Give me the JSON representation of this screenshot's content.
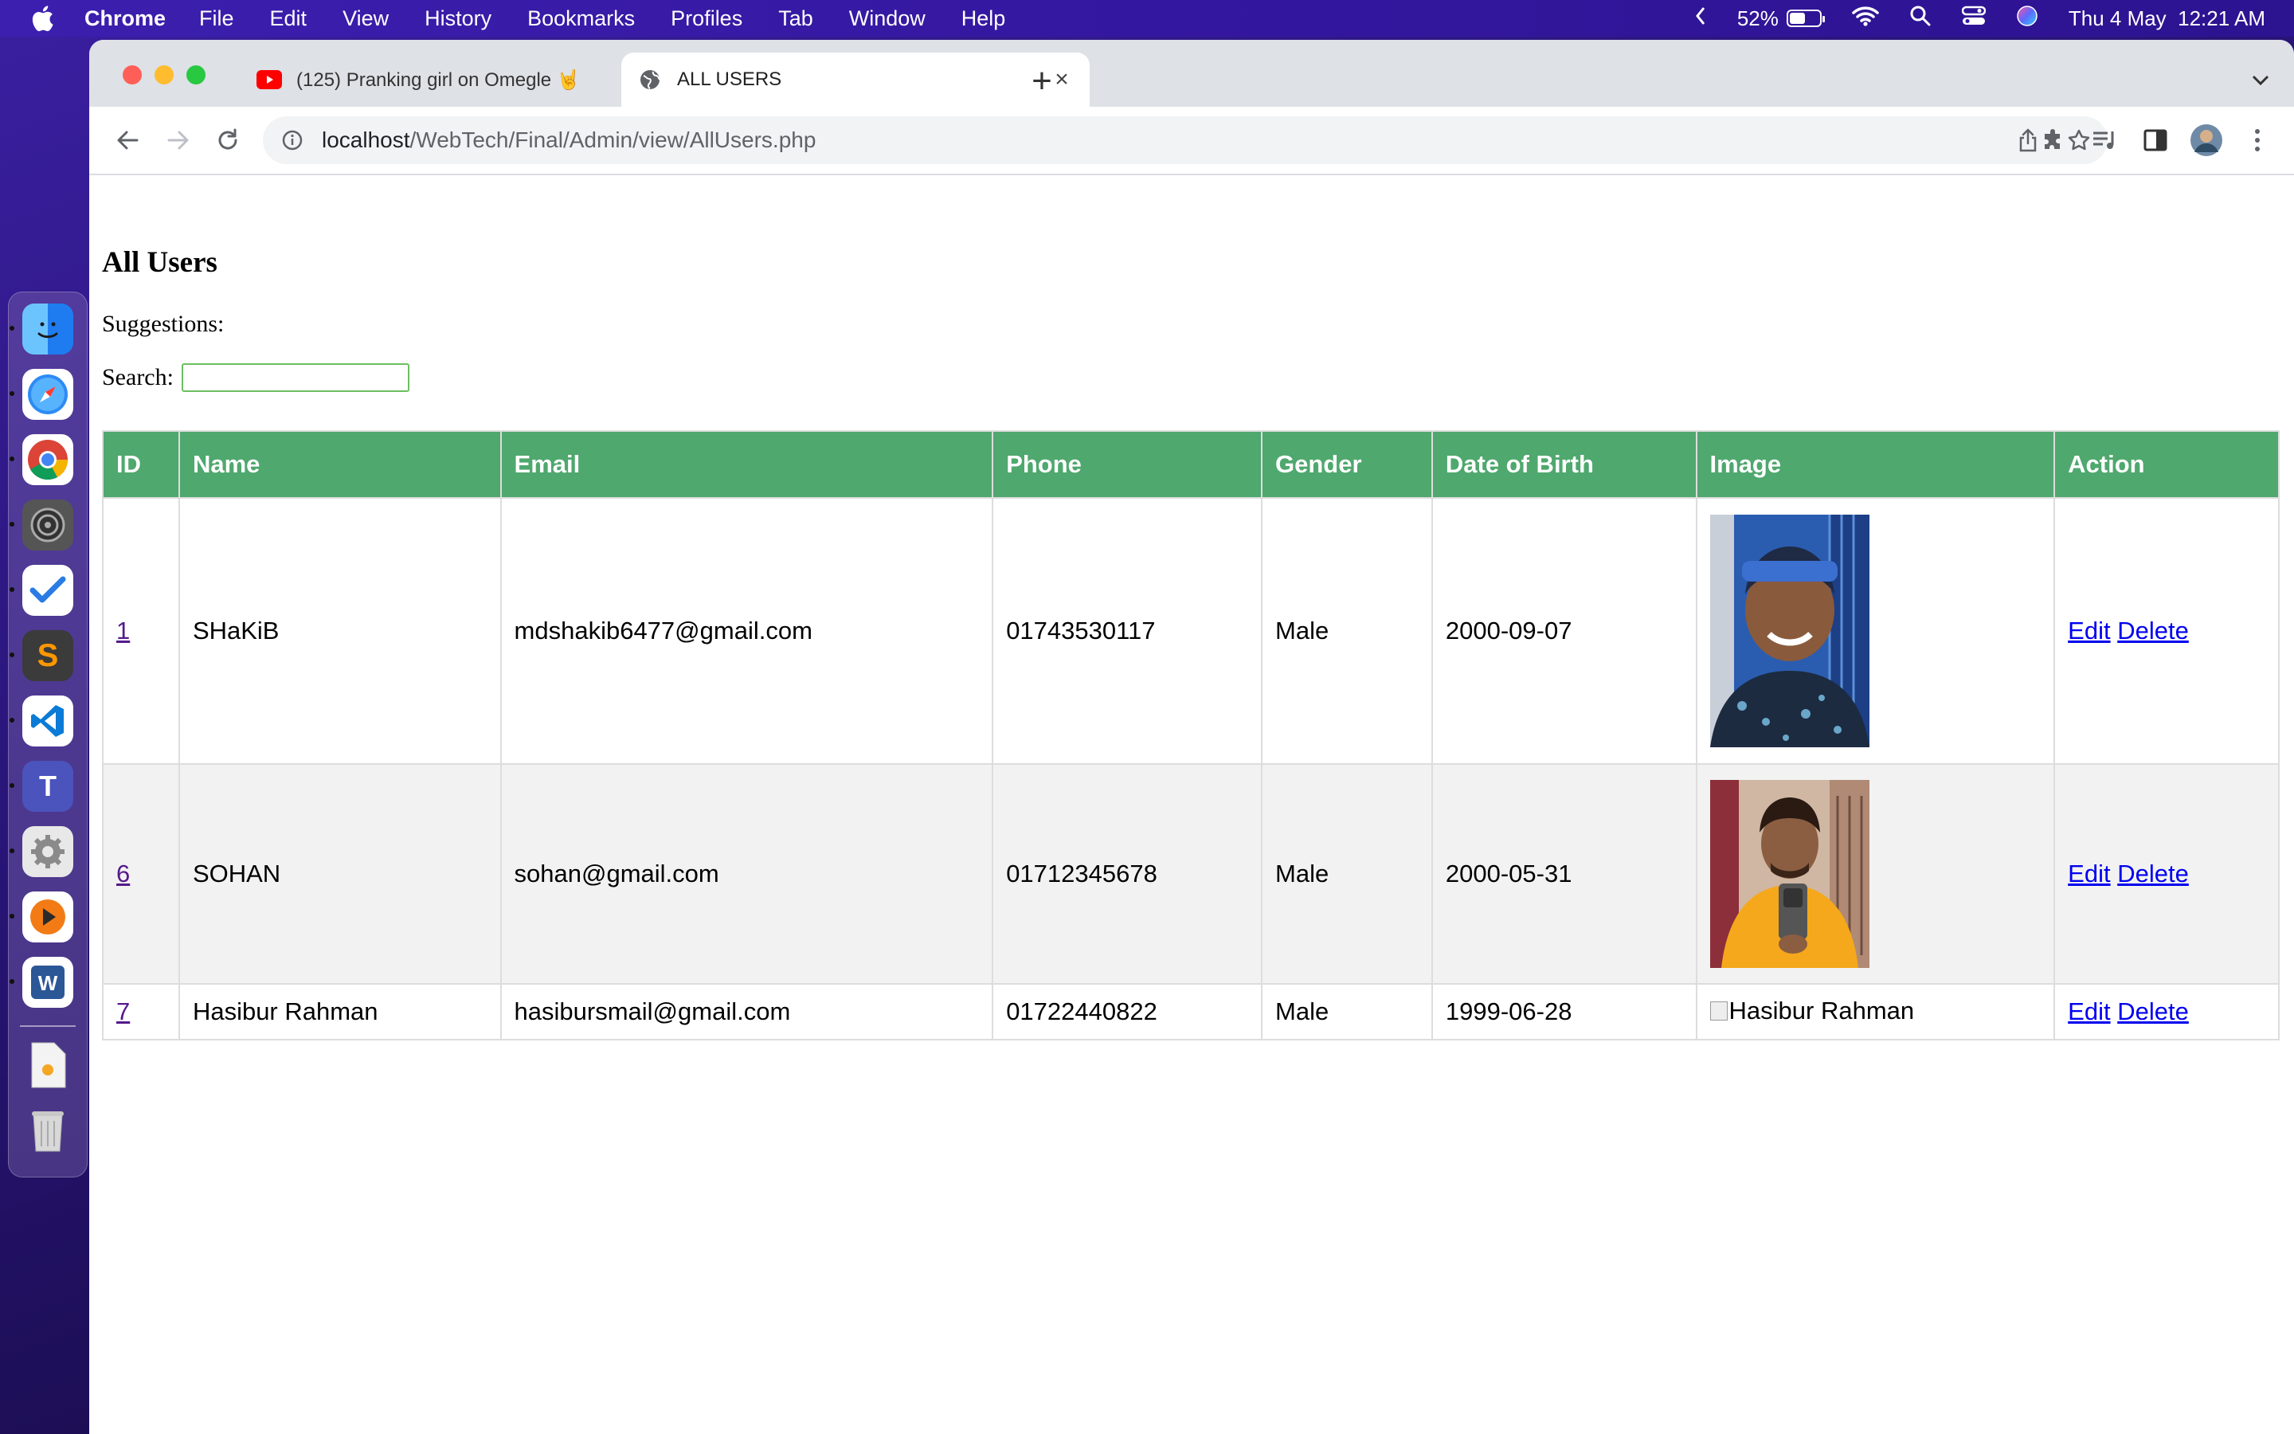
{
  "menubar": {
    "app_name": "Chrome",
    "menus": [
      "File",
      "Edit",
      "View",
      "History",
      "Bookmarks",
      "Profiles",
      "Tab",
      "Window",
      "Help"
    ],
    "battery_percent": "52%",
    "battery_level": 0.52,
    "datetime": "Thu 4 May  12:21 AM"
  },
  "tabs": [
    {
      "title": "(125) Pranking girl on Omegle 🤘",
      "icon": "youtube-icon",
      "active": false
    },
    {
      "title": "ALL USERS",
      "icon": "globe-icon",
      "active": true
    }
  ],
  "address_bar": {
    "host": "localhost",
    "path": "/WebTech/Final/Admin/view/AllUsers.php"
  },
  "page": {
    "title": "All Users",
    "suggestions_label": "Suggestions:",
    "search_label": "Search:",
    "search_value": "",
    "table": {
      "headers": [
        "ID",
        "Name",
        "Email",
        "Phone",
        "Gender",
        "Date of Birth",
        "Image",
        "Action"
      ],
      "rows": [
        {
          "id": "1",
          "name": "SHaKiB",
          "email": "mdshakib6477@gmail.com",
          "phone": "01743530117",
          "gender": "Male",
          "dob": "2000-09-07",
          "image_alt": "",
          "edit": "Edit",
          "delete": "Delete"
        },
        {
          "id": "6",
          "name": "SOHAN",
          "email": "sohan@gmail.com",
          "phone": "01712345678",
          "gender": "Male",
          "dob": "2000-05-31",
          "image_alt": "",
          "edit": "Edit",
          "delete": "Delete"
        },
        {
          "id": "7",
          "name": "Hasibur Rahman",
          "email": "hasibursmail@gmail.com",
          "phone": "01722440822",
          "gender": "Male",
          "dob": "1999-06-28",
          "image_alt": "Hasibur Rahman",
          "edit": "Edit",
          "delete": "Delete"
        }
      ]
    }
  },
  "colors": {
    "table_header": "#4fa86e",
    "link": "#0000ee",
    "visited_link": "#551a8b",
    "search_border": "#6bbf60"
  },
  "dock": [
    "finder-icon",
    "safari-icon",
    "chrome-icon",
    "system-settings-icon",
    "tasks-icon",
    "sublime-text-icon",
    "vscode-icon",
    "teams-icon",
    "settings-gear-icon",
    "media-player-icon",
    "word-icon",
    "document-icon",
    "trash-icon"
  ]
}
